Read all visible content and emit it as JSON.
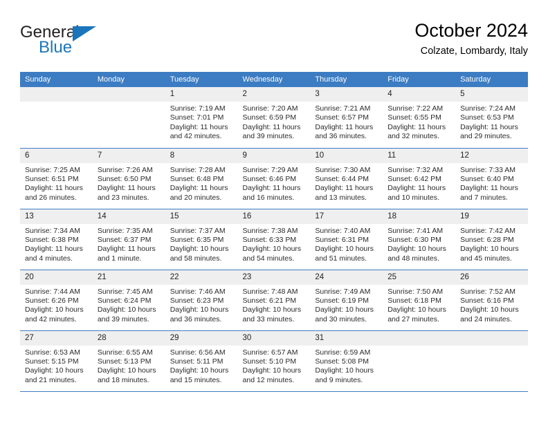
{
  "brand": {
    "name_top": "General",
    "name_bottom": "Blue",
    "accent_color": "#1b75bb"
  },
  "header": {
    "title": "October 2024",
    "subtitle": "Colzate, Lombardy, Italy",
    "header_bg_color": "#3c7cc2",
    "daynum_bg_color": "#efeff0"
  },
  "weekdays": [
    "Sunday",
    "Monday",
    "Tuesday",
    "Wednesday",
    "Thursday",
    "Friday",
    "Saturday"
  ],
  "labels": {
    "sunrise": "Sunrise:",
    "sunset": "Sunset:",
    "daylight": "Daylight:"
  },
  "weeks": [
    [
      {
        "day": "",
        "blank": true,
        "sunrise": "",
        "sunset": "",
        "daylight_1": "",
        "daylight_2": ""
      },
      {
        "day": "",
        "blank": true,
        "sunrise": "",
        "sunset": "",
        "daylight_1": "",
        "daylight_2": ""
      },
      {
        "day": "1",
        "blank": false,
        "sunrise": "Sunrise: 7:19 AM",
        "sunset": "Sunset: 7:01 PM",
        "daylight_1": "Daylight: 11 hours",
        "daylight_2": "and 42 minutes."
      },
      {
        "day": "2",
        "blank": false,
        "sunrise": "Sunrise: 7:20 AM",
        "sunset": "Sunset: 6:59 PM",
        "daylight_1": "Daylight: 11 hours",
        "daylight_2": "and 39 minutes."
      },
      {
        "day": "3",
        "blank": false,
        "sunrise": "Sunrise: 7:21 AM",
        "sunset": "Sunset: 6:57 PM",
        "daylight_1": "Daylight: 11 hours",
        "daylight_2": "and 36 minutes."
      },
      {
        "day": "4",
        "blank": false,
        "sunrise": "Sunrise: 7:22 AM",
        "sunset": "Sunset: 6:55 PM",
        "daylight_1": "Daylight: 11 hours",
        "daylight_2": "and 32 minutes."
      },
      {
        "day": "5",
        "blank": false,
        "sunrise": "Sunrise: 7:24 AM",
        "sunset": "Sunset: 6:53 PM",
        "daylight_1": "Daylight: 11 hours",
        "daylight_2": "and 29 minutes."
      }
    ],
    [
      {
        "day": "6",
        "blank": false,
        "sunrise": "Sunrise: 7:25 AM",
        "sunset": "Sunset: 6:51 PM",
        "daylight_1": "Daylight: 11 hours",
        "daylight_2": "and 26 minutes."
      },
      {
        "day": "7",
        "blank": false,
        "sunrise": "Sunrise: 7:26 AM",
        "sunset": "Sunset: 6:50 PM",
        "daylight_1": "Daylight: 11 hours",
        "daylight_2": "and 23 minutes."
      },
      {
        "day": "8",
        "blank": false,
        "sunrise": "Sunrise: 7:28 AM",
        "sunset": "Sunset: 6:48 PM",
        "daylight_1": "Daylight: 11 hours",
        "daylight_2": "and 20 minutes."
      },
      {
        "day": "9",
        "blank": false,
        "sunrise": "Sunrise: 7:29 AM",
        "sunset": "Sunset: 6:46 PM",
        "daylight_1": "Daylight: 11 hours",
        "daylight_2": "and 16 minutes."
      },
      {
        "day": "10",
        "blank": false,
        "sunrise": "Sunrise: 7:30 AM",
        "sunset": "Sunset: 6:44 PM",
        "daylight_1": "Daylight: 11 hours",
        "daylight_2": "and 13 minutes."
      },
      {
        "day": "11",
        "blank": false,
        "sunrise": "Sunrise: 7:32 AM",
        "sunset": "Sunset: 6:42 PM",
        "daylight_1": "Daylight: 11 hours",
        "daylight_2": "and 10 minutes."
      },
      {
        "day": "12",
        "blank": false,
        "sunrise": "Sunrise: 7:33 AM",
        "sunset": "Sunset: 6:40 PM",
        "daylight_1": "Daylight: 11 hours",
        "daylight_2": "and 7 minutes."
      }
    ],
    [
      {
        "day": "13",
        "blank": false,
        "sunrise": "Sunrise: 7:34 AM",
        "sunset": "Sunset: 6:38 PM",
        "daylight_1": "Daylight: 11 hours",
        "daylight_2": "and 4 minutes."
      },
      {
        "day": "14",
        "blank": false,
        "sunrise": "Sunrise: 7:35 AM",
        "sunset": "Sunset: 6:37 PM",
        "daylight_1": "Daylight: 11 hours",
        "daylight_2": "and 1 minute."
      },
      {
        "day": "15",
        "blank": false,
        "sunrise": "Sunrise: 7:37 AM",
        "sunset": "Sunset: 6:35 PM",
        "daylight_1": "Daylight: 10 hours",
        "daylight_2": "and 58 minutes."
      },
      {
        "day": "16",
        "blank": false,
        "sunrise": "Sunrise: 7:38 AM",
        "sunset": "Sunset: 6:33 PM",
        "daylight_1": "Daylight: 10 hours",
        "daylight_2": "and 54 minutes."
      },
      {
        "day": "17",
        "blank": false,
        "sunrise": "Sunrise: 7:40 AM",
        "sunset": "Sunset: 6:31 PM",
        "daylight_1": "Daylight: 10 hours",
        "daylight_2": "and 51 minutes."
      },
      {
        "day": "18",
        "blank": false,
        "sunrise": "Sunrise: 7:41 AM",
        "sunset": "Sunset: 6:30 PM",
        "daylight_1": "Daylight: 10 hours",
        "daylight_2": "and 48 minutes."
      },
      {
        "day": "19",
        "blank": false,
        "sunrise": "Sunrise: 7:42 AM",
        "sunset": "Sunset: 6:28 PM",
        "daylight_1": "Daylight: 10 hours",
        "daylight_2": "and 45 minutes."
      }
    ],
    [
      {
        "day": "20",
        "blank": false,
        "sunrise": "Sunrise: 7:44 AM",
        "sunset": "Sunset: 6:26 PM",
        "daylight_1": "Daylight: 10 hours",
        "daylight_2": "and 42 minutes."
      },
      {
        "day": "21",
        "blank": false,
        "sunrise": "Sunrise: 7:45 AM",
        "sunset": "Sunset: 6:24 PM",
        "daylight_1": "Daylight: 10 hours",
        "daylight_2": "and 39 minutes."
      },
      {
        "day": "22",
        "blank": false,
        "sunrise": "Sunrise: 7:46 AM",
        "sunset": "Sunset: 6:23 PM",
        "daylight_1": "Daylight: 10 hours",
        "daylight_2": "and 36 minutes."
      },
      {
        "day": "23",
        "blank": false,
        "sunrise": "Sunrise: 7:48 AM",
        "sunset": "Sunset: 6:21 PM",
        "daylight_1": "Daylight: 10 hours",
        "daylight_2": "and 33 minutes."
      },
      {
        "day": "24",
        "blank": false,
        "sunrise": "Sunrise: 7:49 AM",
        "sunset": "Sunset: 6:19 PM",
        "daylight_1": "Daylight: 10 hours",
        "daylight_2": "and 30 minutes."
      },
      {
        "day": "25",
        "blank": false,
        "sunrise": "Sunrise: 7:50 AM",
        "sunset": "Sunset: 6:18 PM",
        "daylight_1": "Daylight: 10 hours",
        "daylight_2": "and 27 minutes."
      },
      {
        "day": "26",
        "blank": false,
        "sunrise": "Sunrise: 7:52 AM",
        "sunset": "Sunset: 6:16 PM",
        "daylight_1": "Daylight: 10 hours",
        "daylight_2": "and 24 minutes."
      }
    ],
    [
      {
        "day": "27",
        "blank": false,
        "sunrise": "Sunrise: 6:53 AM",
        "sunset": "Sunset: 5:15 PM",
        "daylight_1": "Daylight: 10 hours",
        "daylight_2": "and 21 minutes."
      },
      {
        "day": "28",
        "blank": false,
        "sunrise": "Sunrise: 6:55 AM",
        "sunset": "Sunset: 5:13 PM",
        "daylight_1": "Daylight: 10 hours",
        "daylight_2": "and 18 minutes."
      },
      {
        "day": "29",
        "blank": false,
        "sunrise": "Sunrise: 6:56 AM",
        "sunset": "Sunset: 5:11 PM",
        "daylight_1": "Daylight: 10 hours",
        "daylight_2": "and 15 minutes."
      },
      {
        "day": "30",
        "blank": false,
        "sunrise": "Sunrise: 6:57 AM",
        "sunset": "Sunset: 5:10 PM",
        "daylight_1": "Daylight: 10 hours",
        "daylight_2": "and 12 minutes."
      },
      {
        "day": "31",
        "blank": false,
        "sunrise": "Sunrise: 6:59 AM",
        "sunset": "Sunset: 5:08 PM",
        "daylight_1": "Daylight: 10 hours",
        "daylight_2": "and 9 minutes."
      },
      {
        "day": "",
        "blank": true,
        "sunrise": "",
        "sunset": "",
        "daylight_1": "",
        "daylight_2": ""
      },
      {
        "day": "",
        "blank": true,
        "sunrise": "",
        "sunset": "",
        "daylight_1": "",
        "daylight_2": ""
      }
    ]
  ]
}
